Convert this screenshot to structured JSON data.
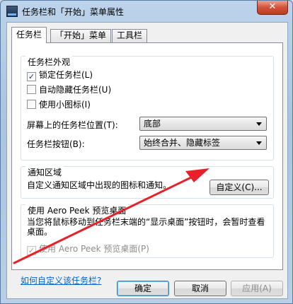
{
  "window": {
    "title": "任务栏和「开始」菜单属性",
    "close_label": "✕"
  },
  "tabs": [
    {
      "label": "任务栏",
      "active": true
    },
    {
      "label": "「开始」菜单",
      "active": false
    },
    {
      "label": "工具栏",
      "active": false
    }
  ],
  "appearance": {
    "title": "任务栏外观",
    "checkboxes": [
      {
        "label": "锁定任务栏(L)",
        "checked": true,
        "mark": "✓"
      },
      {
        "label": "自动隐藏任务栏(U)",
        "checked": false,
        "mark": ""
      },
      {
        "label": "使用小图标(I)",
        "checked": false,
        "mark": ""
      }
    ],
    "position_label": "屏幕上的任务栏位置(T):",
    "position_value": "底部",
    "buttons_label": "任务栏按钮(B):",
    "buttons_value": "始终合并、隐藏标签"
  },
  "notification": {
    "title": "通知区域",
    "description": "自定义通知区域中出现的图标和通知。",
    "customize_label": "自定义(C)..."
  },
  "aero": {
    "title": "使用 Aero Peek 预览桌面",
    "description": "当您将鼠标移动到任务栏末端的“显示桌面”按钮时，会暂时查看桌面。",
    "checkbox_label": "使用 Aero Peek 预览桌面(P)",
    "checkbox_mark": "✓"
  },
  "help_link": "如何自定义该任务栏?",
  "footer": {
    "ok": "确定",
    "cancel": "取消",
    "apply": "应用(A)"
  },
  "annotation_color": "#e8202a"
}
